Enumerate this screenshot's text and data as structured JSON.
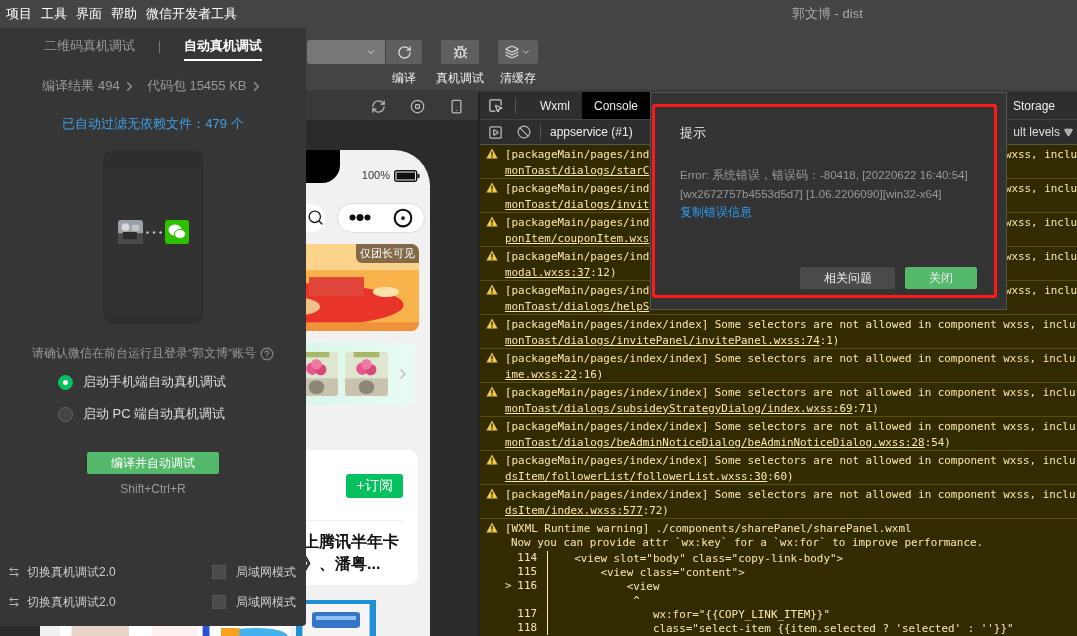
{
  "menu": [
    "项目",
    "工具",
    "界面",
    "帮助",
    "微信开发者工具"
  ],
  "window_title": "郭文博 - dist",
  "toolbar": [
    {
      "kind": "compile",
      "label": "编译"
    },
    {
      "kind": "debug",
      "label": "真机调试"
    },
    {
      "kind": "cache",
      "label": "清缓存"
    }
  ],
  "debug_panel": {
    "tabs": [
      {
        "label": "二维码真机调试",
        "selected": false
      },
      {
        "label": "自动真机调试",
        "selected": true
      }
    ],
    "stats": [
      "编译结果 494",
      "代码包 15455 KB"
    ],
    "filter_note": "已自动过滤无依赖文件：479 个",
    "confirm_note": "请确认微信在前台运行且登录“郭文博”账号",
    "options": [
      {
        "label": "启动手机端自动真机调试",
        "selected": true
      },
      {
        "label": "启动 PC 端自动真机调试",
        "selected": false
      }
    ],
    "action_button": "编译并自动调试",
    "shortcut": "Shift+Ctrl+R",
    "footer_rows": [
      {
        "switch_label": "切换真机调试2.0",
        "checkbox_label": "局域网模式",
        "checked": false
      },
      {
        "switch_label": "切换真机调试2.0",
        "checkbox_label": "局域网模式",
        "checked": false
      }
    ]
  },
  "simulator": {
    "battery": "100%",
    "badge": "仅团长可见",
    "subscribe_button": "+订阅",
    "article_lines": [
      "上腾讯半年卡",
      "》、潘粤..."
    ]
  },
  "devtools": {
    "tabs": [
      {
        "label": "Wxml",
        "selected": false
      },
      {
        "label": "Console",
        "selected": true
      },
      {
        "label": "Storage",
        "selected": false
      }
    ],
    "context": "appservice (#1)",
    "levels": "ult levels",
    "messages": [
      {
        "kind": "covered",
        "head": "[packageMain/pages/ind",
        "head_right": "wxss, inclu",
        "link": "monToast/dialogs/starC"
      },
      {
        "kind": "covered",
        "head": "[packageMain/pages/ind",
        "head_right": "wxss, inclu",
        "link": "monToast/dialogs/invit"
      },
      {
        "kind": "covered",
        "head": "[packageMain/pages/ind",
        "head_right": "wxss, inclu",
        "link": "ponItem/couponItem.wxs"
      },
      {
        "kind": "covered",
        "head": "[packageMain/pages/ind",
        "head_right": "wxss, inclu",
        "link": "modal.wxss:37",
        "tail": ":12)"
      },
      {
        "kind": "covered",
        "head": "[packageMain/pages/ind",
        "head_right": "wxss, inclu",
        "link": "monToast/dialogs/helpS"
      },
      {
        "kind": "full",
        "head": "[packageMain/pages/index/index] Some selectors are not allowed in component wxss, inclu",
        "link": "monToast/dialogs/invitePanel/invitePanel.wxss:74",
        "tail": ":1)"
      },
      {
        "kind": "full",
        "head": "[packageMain/pages/index/index] Some selectors are not allowed in component wxss, inclu",
        "link": "ime.wxss:22",
        "tail": ":16)"
      },
      {
        "kind": "full",
        "head": "[packageMain/pages/index/index] Some selectors are not allowed in component wxss, inclu",
        "link": "monToast/dialogs/subsideyStrategyDialog/index.wxss:69",
        "tail": ":71)"
      },
      {
        "kind": "full",
        "head": "[packageMain/pages/index/index] Some selectors are not allowed in component wxss, inclu",
        "link": "monToast/dialogs/beAdminNoticeDialog/beAdminNoticeDialog.wxss:28",
        "tail": ":54)"
      },
      {
        "kind": "full",
        "head": "[packageMain/pages/index/index] Some selectors are not allowed in component wxss, inclu",
        "link": "dsItem/followerList/followerList.wxss:30",
        "tail": ":60)"
      },
      {
        "kind": "full",
        "head": "[packageMain/pages/index/index] Some selectors are not allowed in component wxss, inclu",
        "link": "dsItem/index.wxss:577",
        "tail": ":72)"
      },
      {
        "kind": "runtime",
        "head": "[WXML Runtime warning] ./components/sharePanel/sharePanel.wxml",
        "note": "Now you can provide attr `wx:key` for a `wx:for` to improve performance.",
        "code": [
          {
            "number": "114",
            "code": "    <view slot=\"body\" class=\"copy-link-body\">"
          },
          {
            "number": "115",
            "code": "        <view class=\"content\">"
          },
          {
            "marker": ">",
            "number": "116",
            "code": "            <view"
          },
          {
            "code": "             ^"
          },
          {
            "number": "117",
            "code": "                wx:for=\"{{COPY_LINK_ITEM}}\""
          },
          {
            "number": "118",
            "code": "                class=\"select-item {{item.selected ? 'selected' : ''}}\""
          }
        ]
      }
    ]
  },
  "dialog": {
    "title": "提示",
    "message": "Error: 系统错误，错误码：-80418, [20220622 16:40:54] [wx2672757b4553d5d7] [1.06.2206090][win32-x64]",
    "link": "复制错误信息",
    "buttons": [
      {
        "kind": "secondary",
        "label": "相关问题"
      },
      {
        "kind": "primary",
        "label": "关闭"
      }
    ]
  }
}
